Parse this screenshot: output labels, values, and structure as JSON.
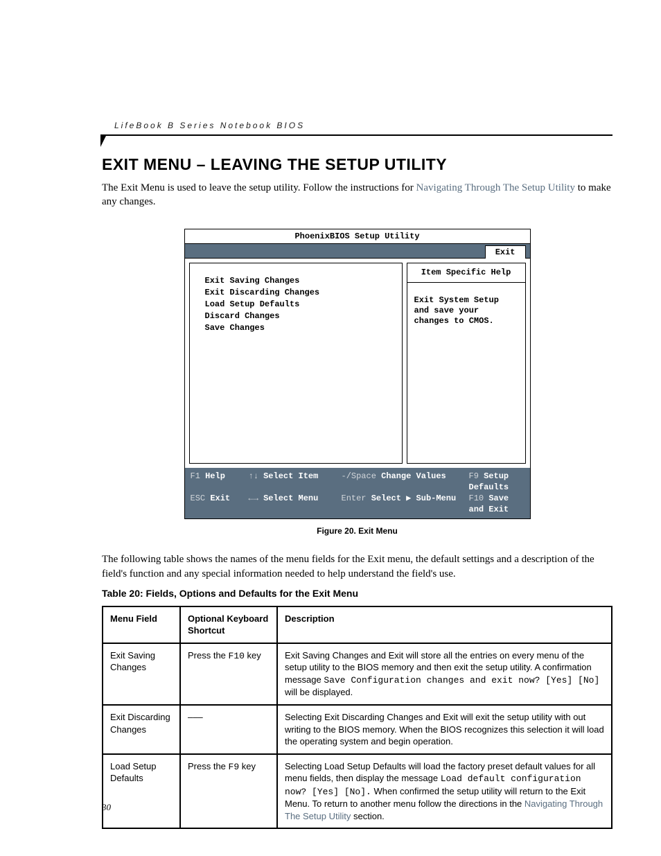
{
  "runningHead": "LifeBook B Series Notebook BIOS",
  "title": "EXIT MENU – LEAVING THE SETUP UTILITY",
  "intro_a": "The Exit Menu is used to leave the setup utility. Follow the instructions for ",
  "intro_link": "Navigating Through The Setup Utility",
  "intro_b": " to make any changes.",
  "bios": {
    "windowTitle": "PhoenixBIOS Setup Utility",
    "activeTab": "Exit",
    "menu": [
      "Exit Saving Changes",
      "Exit Discarding Changes",
      "Load Setup Defaults",
      "Discard Changes",
      "Save Changes"
    ],
    "helpHeader": "Item Specific Help",
    "helpBody": "Exit System Setup and save your changes to CMOS.",
    "footer": {
      "r1": {
        "k1": "F1",
        "l1": "Help",
        "k2": "↑↓",
        "l2": "Select Item",
        "k3": "-/Space",
        "l3": "Change Values",
        "k4": "F9",
        "l4": "Setup Defaults"
      },
      "r2": {
        "k1": "ESC",
        "l1": "Exit",
        "k2": "←→",
        "l2": "Select Menu",
        "k3": "Enter",
        "l3": "Select ▶ Sub-Menu",
        "k4": "F10",
        "l4": "Save and Exit"
      }
    }
  },
  "figCaption": "Figure 20.  Exit Menu",
  "para2": "The following table shows the names of the menu fields for the Exit menu, the default settings and a description of the field's function and any special information needed to help understand the field's use.",
  "tableCaption": "Table 20: Fields, Options and Defaults for the Exit Menu",
  "table": {
    "headers": [
      "Menu Field",
      "Optional Keyboard Shortcut",
      "Description"
    ],
    "rows": [
      {
        "field": "Exit Saving Changes",
        "shortcut_a": "Press the ",
        "shortcut_key": "F10",
        "shortcut_b": " key",
        "desc_a": "Exit Saving Changes and Exit will store all the entries on every menu of the setup utility to the BIOS memory and then exit the setup utility. A confirmation message ",
        "desc_code": "Save Configuration changes and exit now? [Yes] [No]",
        "desc_b": " will be displayed."
      },
      {
        "field": "Exit Discarding Changes",
        "shortcut_plain": "–––",
        "desc_plain": "Selecting Exit Discarding Changes and Exit will exit the setup utility with out writing to the BIOS memory. When the BIOS recognizes this selection it will load the operating system and begin operation."
      },
      {
        "field": "Load Setup Defaults",
        "shortcut_a": "Press the ",
        "shortcut_key": "F9",
        "shortcut_b": " key",
        "desc_a": "Selecting Load Setup Defaults will load the factory preset default values for all menu fields, then display the message ",
        "desc_code": "Load default configuration now? [Yes] [No].",
        "desc_b": " When confirmed the setup utility will return to the Exit Menu. To return to another menu follow the directions in the ",
        "desc_link": "Navigating Through The Setup Utility",
        "desc_c": " section."
      }
    ]
  },
  "pageNumber": "30"
}
